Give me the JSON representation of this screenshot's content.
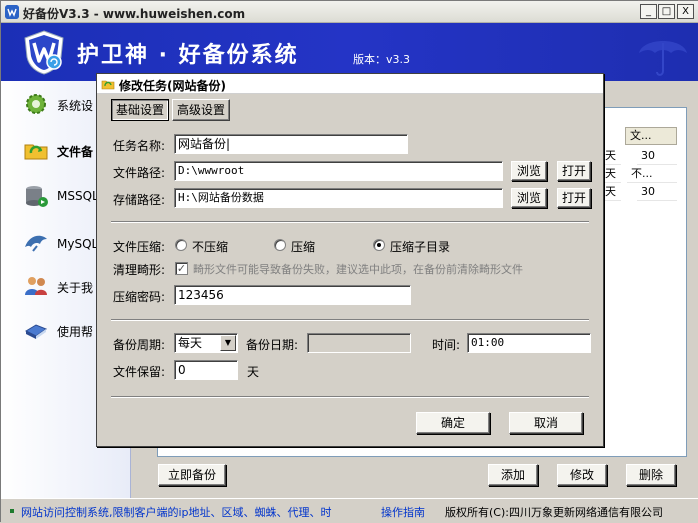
{
  "window": {
    "title": "好备份V3.3 - www.huweishen.com",
    "minimize_label": "_",
    "maximize_label": "□",
    "close_label": "X"
  },
  "banner": {
    "title": "护卫神 · 好备份系统",
    "version": "版本：v3.3"
  },
  "sidebar": {
    "items": [
      {
        "label": "系统设",
        "icon": "gear-icon"
      },
      {
        "label": "文件备",
        "icon": "folder-sync-icon"
      },
      {
        "label": "MSSQL",
        "icon": "database-icon"
      },
      {
        "label": "MySQL备",
        "icon": "dolphin-icon"
      },
      {
        "label": "关于我",
        "icon": "people-icon"
      },
      {
        "label": "使用帮",
        "icon": "book-icon"
      }
    ]
  },
  "background_list": {
    "header": "文...",
    "rows": [
      "30",
      "不...",
      "30"
    ],
    "row_prefix": [
      "天",
      "天",
      "天"
    ]
  },
  "content_buttons": {
    "backup_now": "立即备份",
    "add": "添加",
    "edit": "修改",
    "delete": "删除"
  },
  "status_bar": {
    "marquee": "网站访问控制系统,限制客户端的ip地址、区域、蜘蛛、代理、时",
    "guide": "操作指南",
    "copyright": "版权所有(C):四川万象更新网络通信有限公司"
  },
  "dialog": {
    "title": "修改任务(网站备份)",
    "tabs": [
      "基础设置",
      "高级设置"
    ],
    "task_name_label": "任务名称:",
    "task_name_value": "网站备份|",
    "file_path_label": "文件路径:",
    "file_path_value": "D:\\wwwroot",
    "store_path_label": "存储路径:",
    "store_path_value": "H:\\网站备份数据",
    "browse_label": "浏览",
    "open_label": "打开",
    "compress_label": "文件压缩:",
    "compress_options": [
      "不压缩",
      "压缩",
      "压缩子目录"
    ],
    "compress_selected": 2,
    "clean_label": "清理畸形:",
    "clean_checked": true,
    "clean_hint": "畸形文件可能导致备份失败，建议选中此项，在备份前清除畸形文件",
    "password_label": "压缩密码:",
    "password_value": "123456",
    "period_label": "备份周期:",
    "period_value": "每天",
    "date_label": "备份日期:",
    "date_value": "",
    "time_label": "时间:",
    "time_value": "01:00",
    "retain_label": "文件保留:",
    "retain_value": "0",
    "retain_unit": "天",
    "ok_label": "确定",
    "cancel_label": "取消"
  },
  "colors": {
    "banner_blue": "#1f30b8",
    "status_link": "#0033cc",
    "dialog_bg": "#d4d0c8"
  }
}
